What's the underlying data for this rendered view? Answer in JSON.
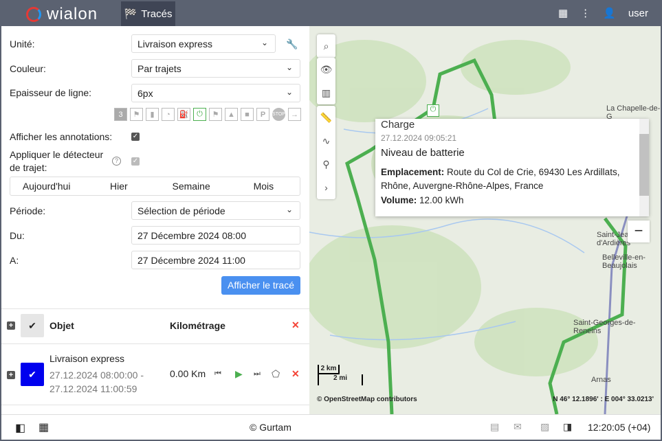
{
  "header": {
    "logo": "wialon",
    "tab": "Tracés",
    "user": "user"
  },
  "form": {
    "unit_label": "Unité:",
    "unit_value": "Livraison express",
    "color_label": "Couleur:",
    "color_value": "Par trajets",
    "width_label": "Epaisseur de ligne:",
    "width_value": "6px",
    "annot_label": "Afficher les annotations:",
    "detector_label_1": "Appliquer le détecteur",
    "detector_label_2": "de trajet:",
    "periods": [
      "Aujourd'hui",
      "Hier",
      "Semaine",
      "Mois"
    ],
    "period_label": "Période:",
    "period_value": "Sélection de période",
    "from_label": "Du:",
    "from_value": "27 Décembre 2024 08:00",
    "to_label": "A:",
    "to_value": "27 Décembre 2024 11:00",
    "submit": "Afficher le tracé"
  },
  "table": {
    "col_object": "Objet",
    "col_mileage": "Kilométrage",
    "row": {
      "name": "Livraison express",
      "from": "27.12.2024 08:00:00 -",
      "to": "27.12.2024 11:00:59",
      "mileage": "0.00 Km"
    }
  },
  "popup": {
    "title": "Charge",
    "time": "27.12.2024 09:05:21",
    "subtitle": "Niveau de batterie",
    "loc_label": "Emplacement:",
    "loc_value": "Route du Col de Crie, 69430 Les Ardillats, Rhône, Auvergne-Rhône-Alpes, France",
    "vol_label": "Volume:",
    "vol_value": "12.00 kWh"
  },
  "map": {
    "places": [
      "La Chapelle-de-G",
      "Saint-Jean-d'Ardières",
      "Belleville-en-Beaujolais",
      "Saint-Georges-de-Reneins",
      "Arnas"
    ],
    "scale_km": "2 km",
    "scale_mi": "2 mi",
    "attribution": "© OpenStreetMap contributors",
    "coords": "N 46° 12.1896' : E 004° 33.0213'"
  },
  "footer": {
    "copyright": "© Gurtam",
    "time": "12:20:05 (+04)"
  },
  "colors": {
    "track": "#4caf50",
    "accent": "#4a90f0",
    "selected": "#0000ee"
  }
}
